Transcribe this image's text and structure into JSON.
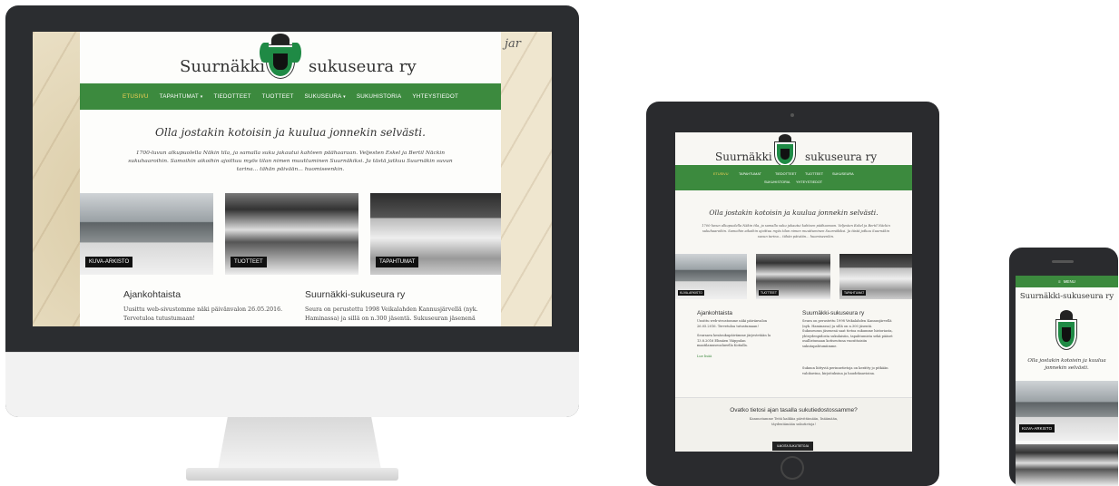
{
  "site": {
    "title_left": "Suurnäkki",
    "title_right": "sukuseura ry",
    "title_full": "Suurnäkki-sukuseura ry",
    "tagline": "Olla jostakin kotoisin ja kuulua jonnekin selvästi.",
    "intro": "1700-luvun alkupuolella Näkin tila, ja samalla suku jakautui kahteen päähaaraan. Veljesten Eskel ja Bertil Näckin sukuhaaroihin. Samoihin aikoihin ajoittuu myös tilan nimen muuttuminen Suurnäkiksi. Ja tästä jatkuu Suurnäkin suvun tarina... tähän päivään... huomiseenkin."
  },
  "nav": {
    "items": [
      {
        "label": "ETUSIVU"
      },
      {
        "label": "TAPAHTUMAT"
      },
      {
        "label": "TIEDOTTEET"
      },
      {
        "label": "TUOTTEET"
      },
      {
        "label": "SUKUSEURA"
      },
      {
        "label": "SUKUHISTORIA"
      },
      {
        "label": "YHTEYSTIEDOT"
      }
    ],
    "menu_label": "MENU"
  },
  "tiles": [
    {
      "label": "KUVA-ARKISTO"
    },
    {
      "label": "TUOTTEET"
    },
    {
      "label": "TAPAHTUMAT"
    }
  ],
  "news": {
    "title": "Ajankohtaista",
    "text_1": "Uusittu web-sivustomme näki päivänvalon 26.05.2016. Tervetuloa tutustumaan!",
    "text_2": "Seuraava kesäsukupäivämme järjestetään la 13.8.2016 Elimäen Väippulan maatilamuseoalueella Kotialla.",
    "more": "Lue lisää"
  },
  "about": {
    "title": "Suurnäkki-sukuseura ry",
    "text_desktop": "Seura on perustettu 1998 Veikalahden Kannusjärvellä (nyk. Haminassa) ja sillä on n.300 jäsentä. Sukuseuran jäsenenä",
    "text_tablet": "Seura on perustettu 1998 Veikalahden Kannusjärvellä (nyk. Haminassa) ja sillä on n.300 jäsentä. Sukuseuran jäsenenä saat tietoa sukumme historiasta, yhteydenpidosta sukulaisiin, tapahtumista sekä pääset osallistumaan kotiseutuna vuosittaisiin sukutapahtumiimme.",
    "text_tablet_2": "Sukuun liittyviä perinnetietoja on kerätty jo pitkään valokuvina, kirjoituksina ja haudekaavioina."
  },
  "cta": {
    "question": "Ovatko tietosi ajan tasalla sukutiedostossamme?",
    "text": "Kannustamme Teitä kaikkia päivittämään, lisäämään, täydentämään sukutietoja!",
    "button": "ILMOITA SUKUTIETOJA"
  },
  "colors": {
    "nav_green": "#3c8a3e",
    "active_yellow": "#f3d155",
    "device_dark": "#2b2d30"
  },
  "icons": {
    "menu": "hamburger-icon",
    "dropdown": "caret-down-icon",
    "crest": "coat-of-arms-icon"
  }
}
